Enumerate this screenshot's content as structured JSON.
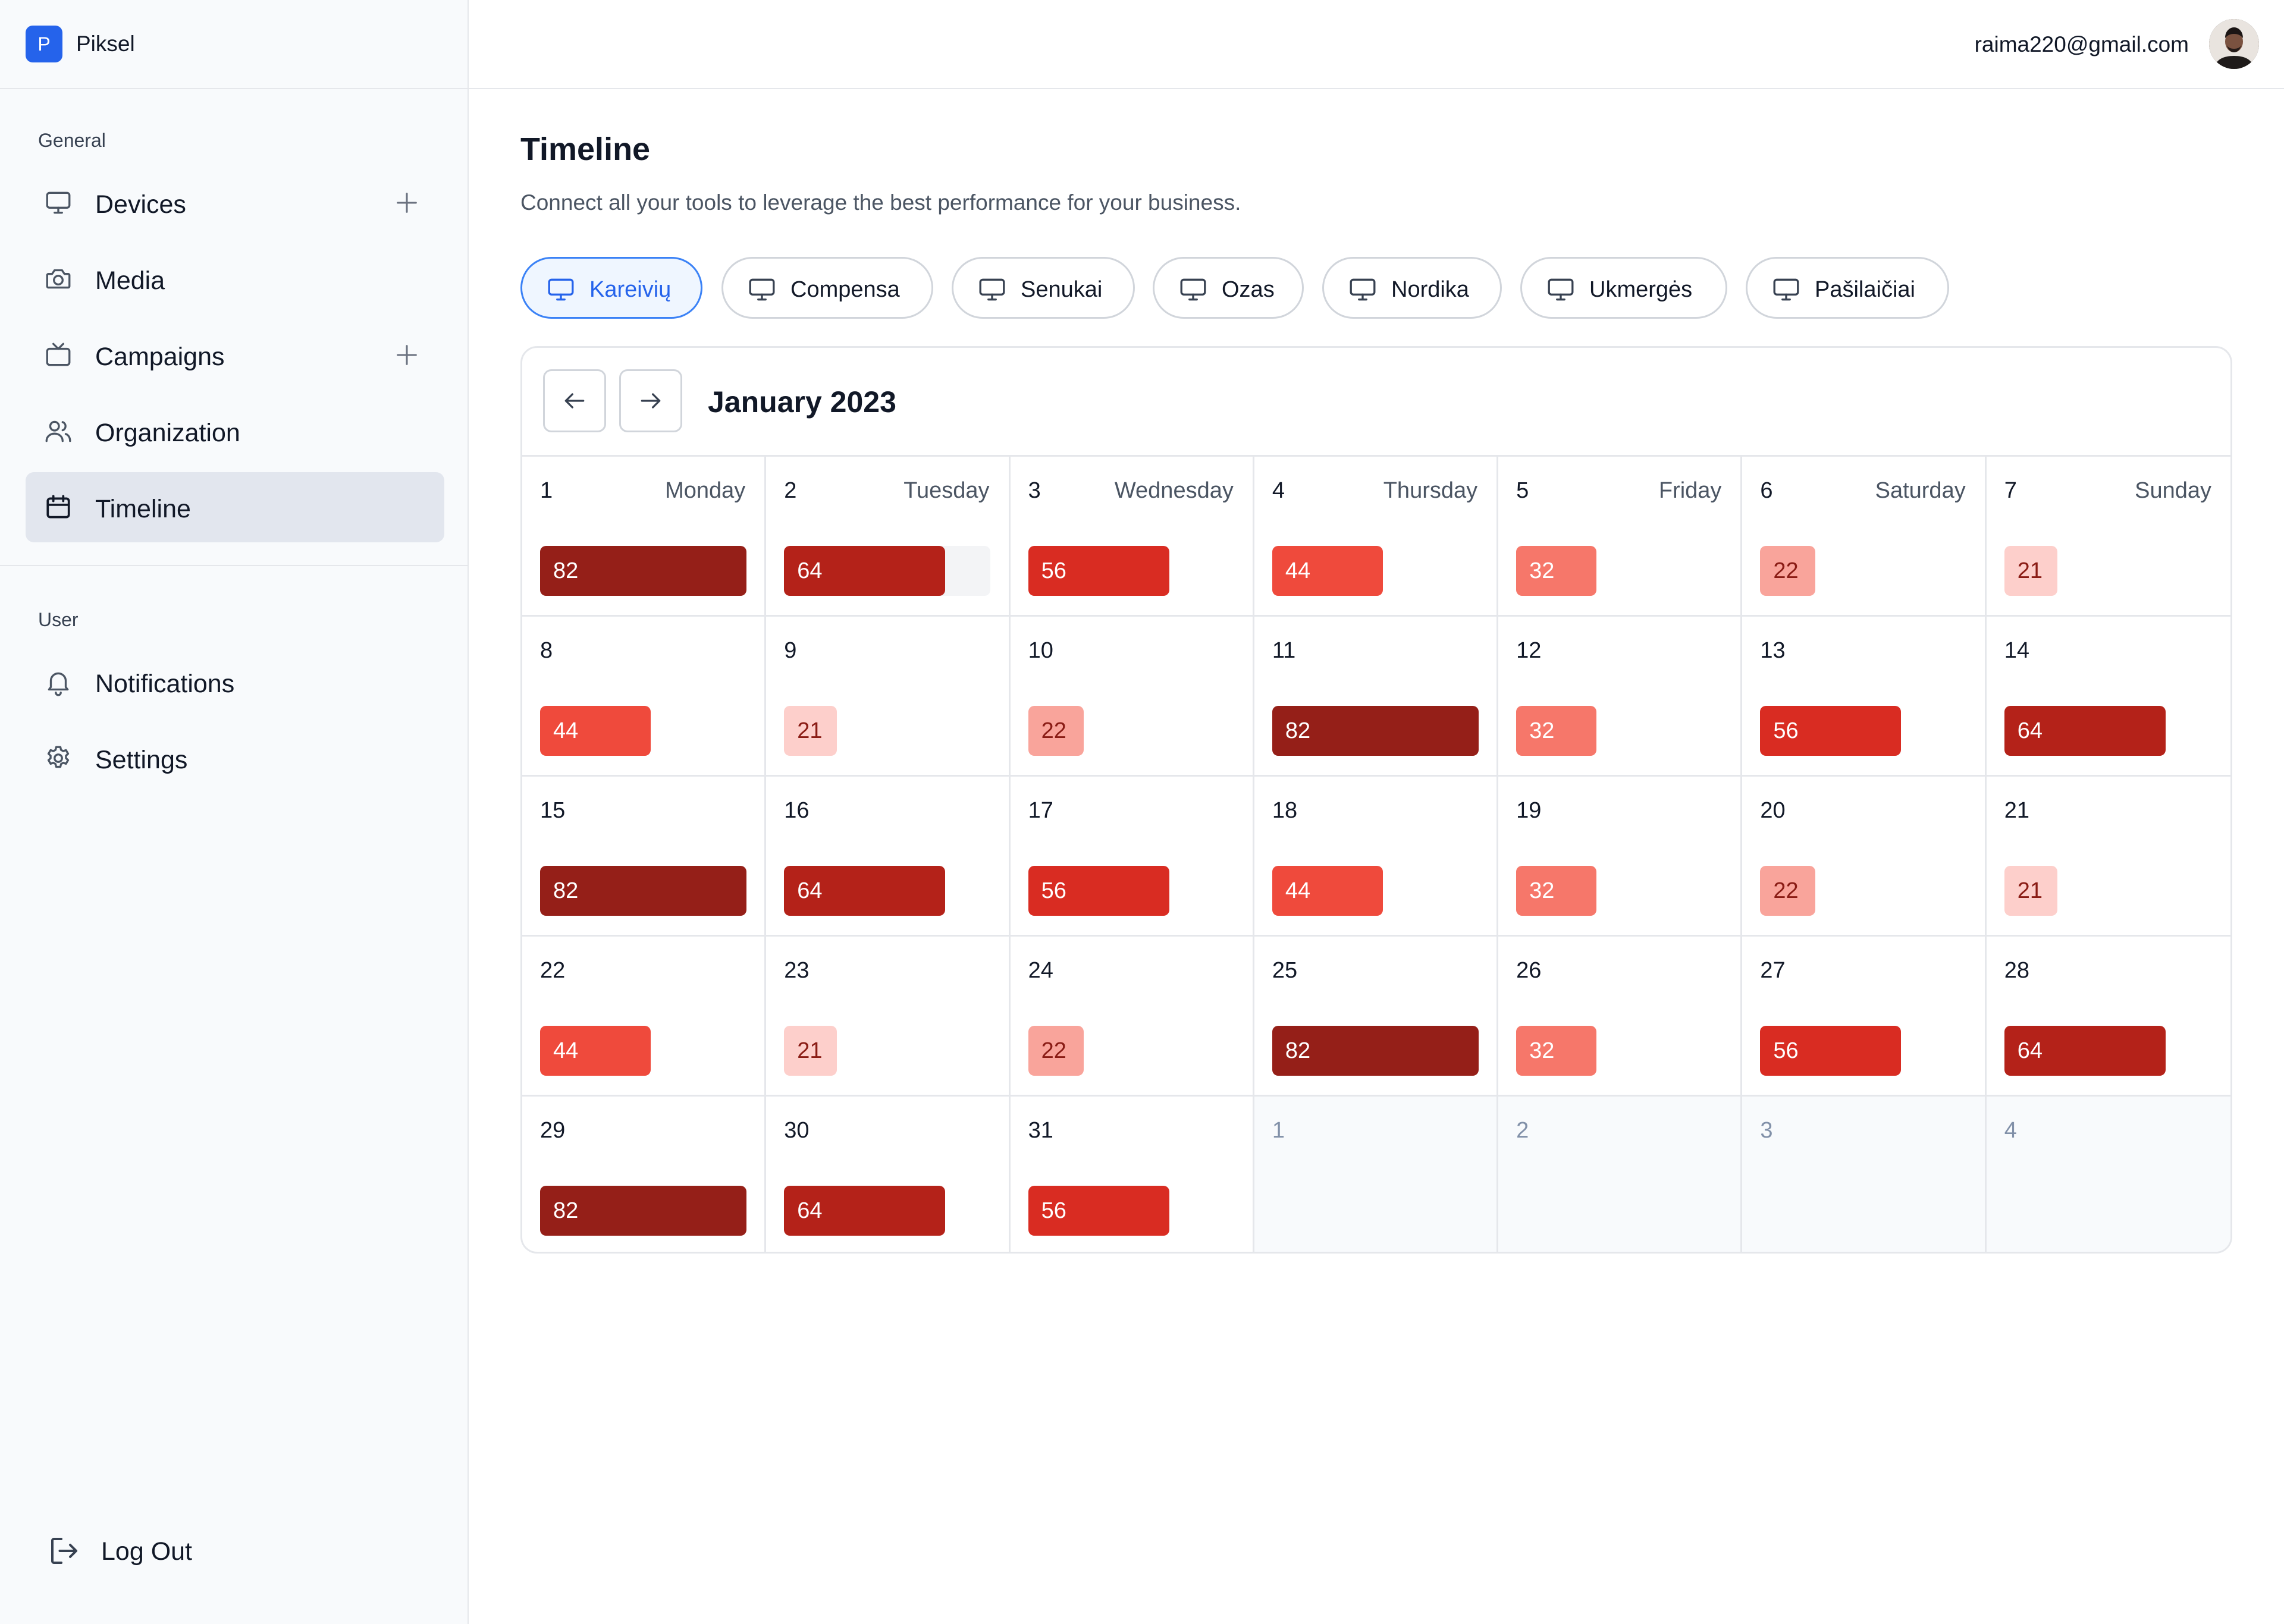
{
  "brand": {
    "logo_letter": "P",
    "name": "Piksel"
  },
  "user": {
    "email": "raima220@gmail.com"
  },
  "sidebar": {
    "general_title": "General",
    "user_title": "User",
    "general_items": [
      {
        "label": "Devices",
        "icon": "monitor-icon",
        "has_add": true
      },
      {
        "label": "Media",
        "icon": "camera-icon",
        "has_add": false
      },
      {
        "label": "Campaigns",
        "icon": "tv-icon",
        "has_add": true
      },
      {
        "label": "Organization",
        "icon": "users-icon",
        "has_add": false
      },
      {
        "label": "Timeline",
        "icon": "calendar-icon",
        "has_add": false,
        "active": true
      }
    ],
    "user_items": [
      {
        "label": "Notifications",
        "icon": "bell-icon"
      },
      {
        "label": "Settings",
        "icon": "gear-icon"
      }
    ],
    "logout_label": "Log Out"
  },
  "page": {
    "title": "Timeline",
    "subtitle": "Connect all your tools to leverage the best performance for your business."
  },
  "device_tabs": [
    {
      "label": "Kareivių",
      "active": true
    },
    {
      "label": "Compensa"
    },
    {
      "label": "Senukai"
    },
    {
      "label": "Ozas"
    },
    {
      "label": "Nordika"
    },
    {
      "label": "Ukmergės"
    },
    {
      "label": "Pašilaičiai"
    }
  ],
  "calendar": {
    "month_label": "January 2023",
    "weekdays": [
      "Monday",
      "Tuesday",
      "Wednesday",
      "Thursday",
      "Friday",
      "Saturday",
      "Sunday"
    ],
    "days": [
      {
        "day": "1",
        "value": 82
      },
      {
        "day": "2",
        "value": 64,
        "track": true
      },
      {
        "day": "3",
        "value": 56
      },
      {
        "day": "4",
        "value": 44
      },
      {
        "day": "5",
        "value": 32
      },
      {
        "day": "6",
        "value": 22
      },
      {
        "day": "7",
        "value": 21
      },
      {
        "day": "8",
        "value": 44
      },
      {
        "day": "9",
        "value": 21
      },
      {
        "day": "10",
        "value": 22
      },
      {
        "day": "11",
        "value": 82
      },
      {
        "day": "12",
        "value": 32
      },
      {
        "day": "13",
        "value": 56
      },
      {
        "day": "14",
        "value": 64
      },
      {
        "day": "15",
        "value": 82
      },
      {
        "day": "16",
        "value": 64
      },
      {
        "day": "17",
        "value": 56
      },
      {
        "day": "18",
        "value": 44
      },
      {
        "day": "19",
        "value": 32
      },
      {
        "day": "20",
        "value": 22
      },
      {
        "day": "21",
        "value": 21
      },
      {
        "day": "22",
        "value": 44
      },
      {
        "day": "23",
        "value": 21
      },
      {
        "day": "24",
        "value": 22
      },
      {
        "day": "25",
        "value": 82
      },
      {
        "day": "26",
        "value": 32
      },
      {
        "day": "27",
        "value": 56
      },
      {
        "day": "28",
        "value": 64
      },
      {
        "day": "29",
        "value": 82
      },
      {
        "day": "30",
        "value": 64
      },
      {
        "day": "31",
        "value": 56
      },
      {
        "day": "1",
        "outside": true
      },
      {
        "day": "2",
        "outside": true
      },
      {
        "day": "3",
        "outside": true
      },
      {
        "day": "4",
        "outside": true
      }
    ],
    "level_colors": {
      "82": {
        "bg": "#951f18",
        "fg": "#ffffff"
      },
      "64": {
        "bg": "#b42219",
        "fg": "#ffffff"
      },
      "56": {
        "bg": "#d92c22",
        "fg": "#ffffff"
      },
      "44": {
        "bg": "#ef4a3c",
        "fg": "#ffffff"
      },
      "32": {
        "bg": "#f6776a",
        "fg": "#ffffff"
      },
      "22": {
        "bg": "#f9a49b",
        "fg": "#8a1c15"
      },
      "21": {
        "bg": "#fdcfcb",
        "fg": "#8a1c15"
      }
    },
    "scale_max": 82
  }
}
